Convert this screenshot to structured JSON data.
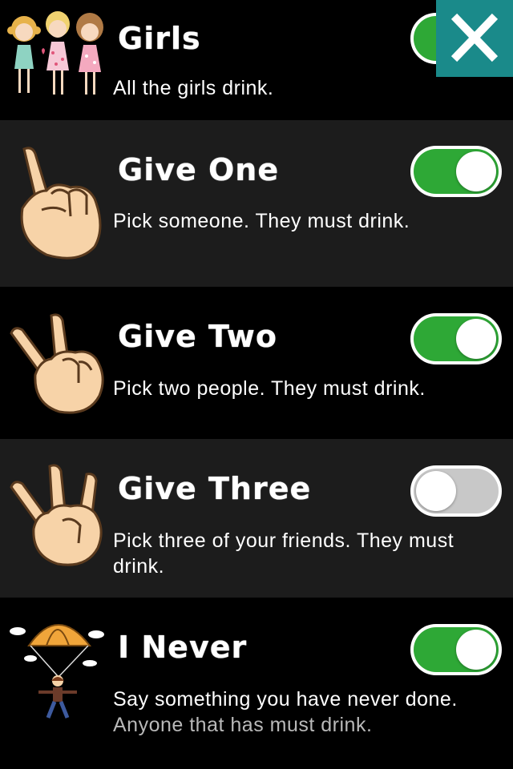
{
  "rules": [
    {
      "id": "girls",
      "title": "Girls",
      "description": "All the girls drink.",
      "subtext": "",
      "enabled": true,
      "icon": "three-girls-icon"
    },
    {
      "id": "give-one",
      "title": "Give One",
      "description": "Pick someone. They must drink.",
      "subtext": "",
      "enabled": true,
      "icon": "one-finger-hand-icon"
    },
    {
      "id": "give-two",
      "title": "Give Two",
      "description": "Pick two people. They must drink.",
      "subtext": "",
      "enabled": true,
      "icon": "two-finger-hand-icon"
    },
    {
      "id": "give-three",
      "title": "Give Three",
      "description": "Pick three of your friends. They must drink.",
      "subtext": "",
      "enabled": false,
      "icon": "three-finger-hand-icon"
    },
    {
      "id": "i-never",
      "title": "I Never",
      "description": "Say something you have never done.",
      "subtext": "Anyone that has must drink.",
      "enabled": true,
      "icon": "parachute-man-icon"
    }
  ],
  "close_button": {
    "icon": "close-icon"
  },
  "colors": {
    "toggle_on": "#2ea836",
    "toggle_off": "#c8c8c8",
    "close_bg": "#1a8a8a",
    "row_alt": "#1c1c1c"
  }
}
